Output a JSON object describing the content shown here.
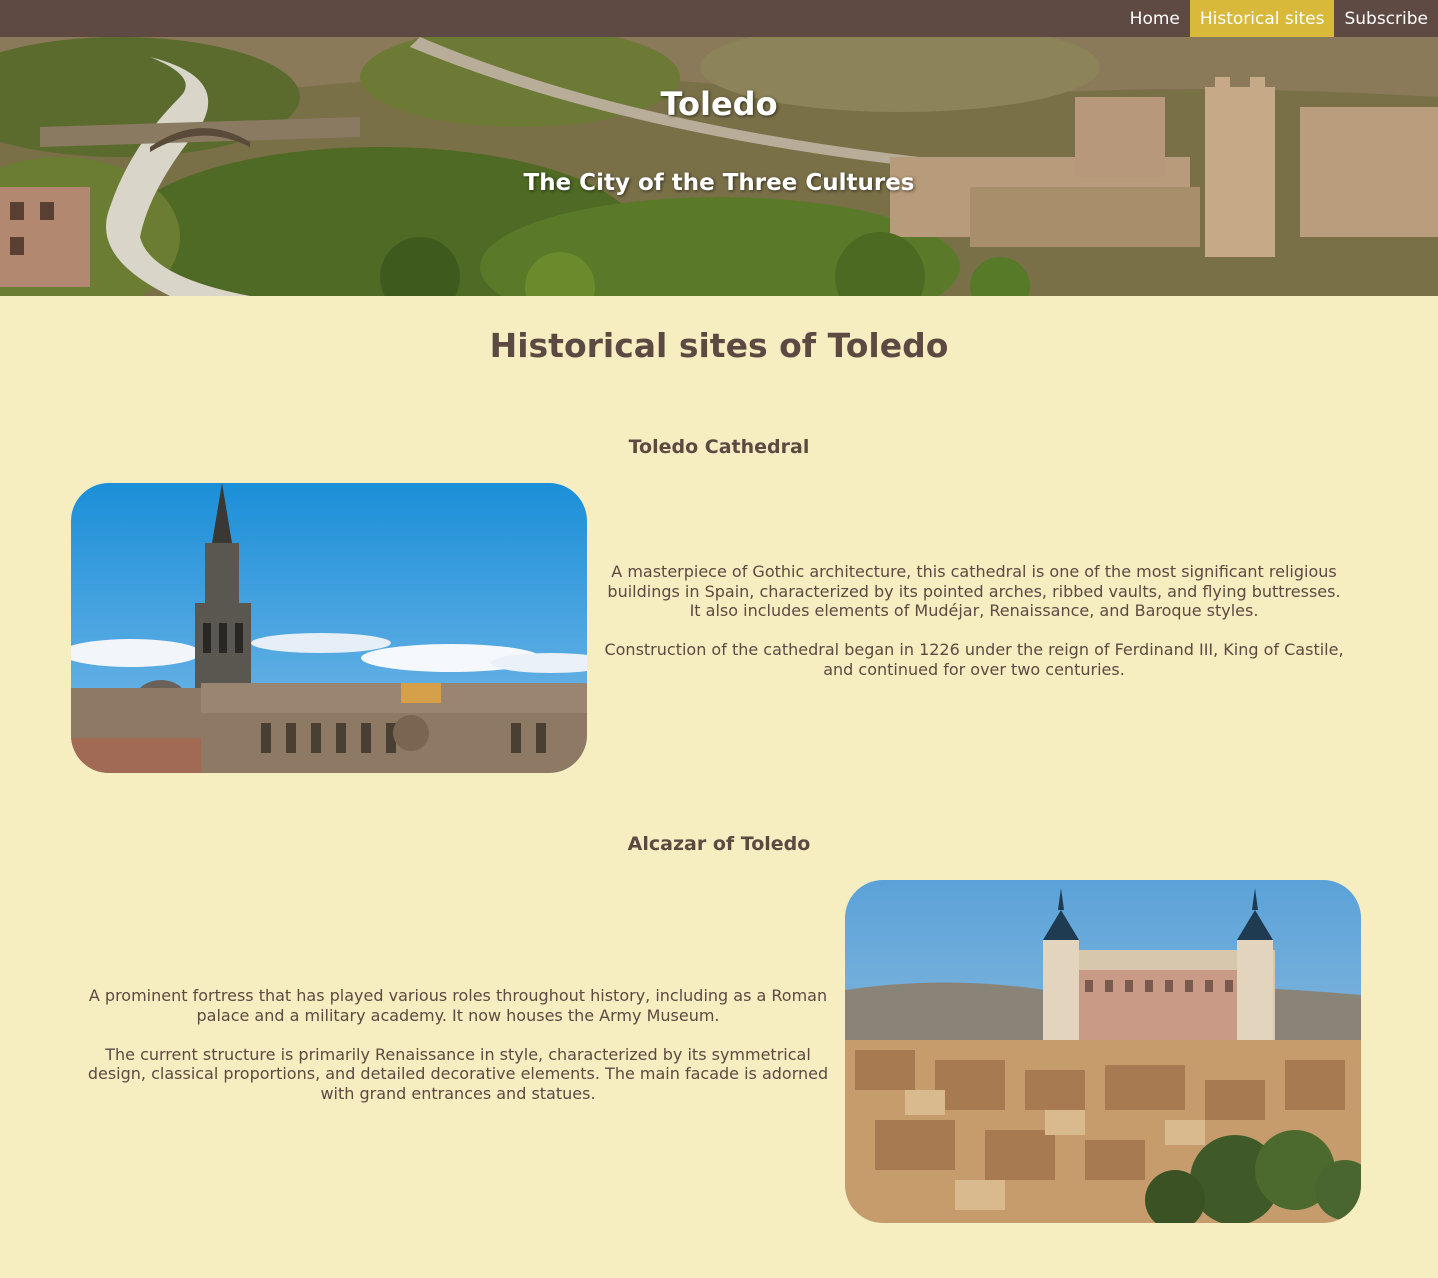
{
  "nav": {
    "items": [
      {
        "label": "Home",
        "active": false
      },
      {
        "label": "Historical sites",
        "active": true
      },
      {
        "label": "Subscribe",
        "active": false
      }
    ]
  },
  "hero": {
    "title": "Toledo",
    "subtitle": "The City of the Three Cultures"
  },
  "main": {
    "heading": "Historical sites of Toledo",
    "sites": [
      {
        "title": "Toledo Cathedral",
        "paragraphs": [
          "A masterpiece of Gothic architecture, this cathedral is one of the most significant religious buildings in Spain, characterized by its pointed arches, ribbed vaults, and flying buttresses. It also includes elements of Mudéjar, Renaissance, and Baroque styles.",
          "Construction of the cathedral began in 1226 under the reign of Ferdinand III, King of Castile, and continued for over two centuries."
        ]
      },
      {
        "title": "Alcazar of Toledo",
        "paragraphs": [
          "A prominent fortress that has played various roles throughout history, including as a Roman palace and a military academy. It now houses the Army Museum.",
          "The current structure is primarily Renaissance in style, characterized by its symmetrical design, classical proportions, and detailed decorative elements. The main facade is adorned with grand entrances and statues."
        ]
      }
    ]
  },
  "colors": {
    "nav_bg": "#5e4a43",
    "nav_active": "#d8b93a",
    "page_bg": "#f6edc1",
    "text": "#5c4a42"
  }
}
